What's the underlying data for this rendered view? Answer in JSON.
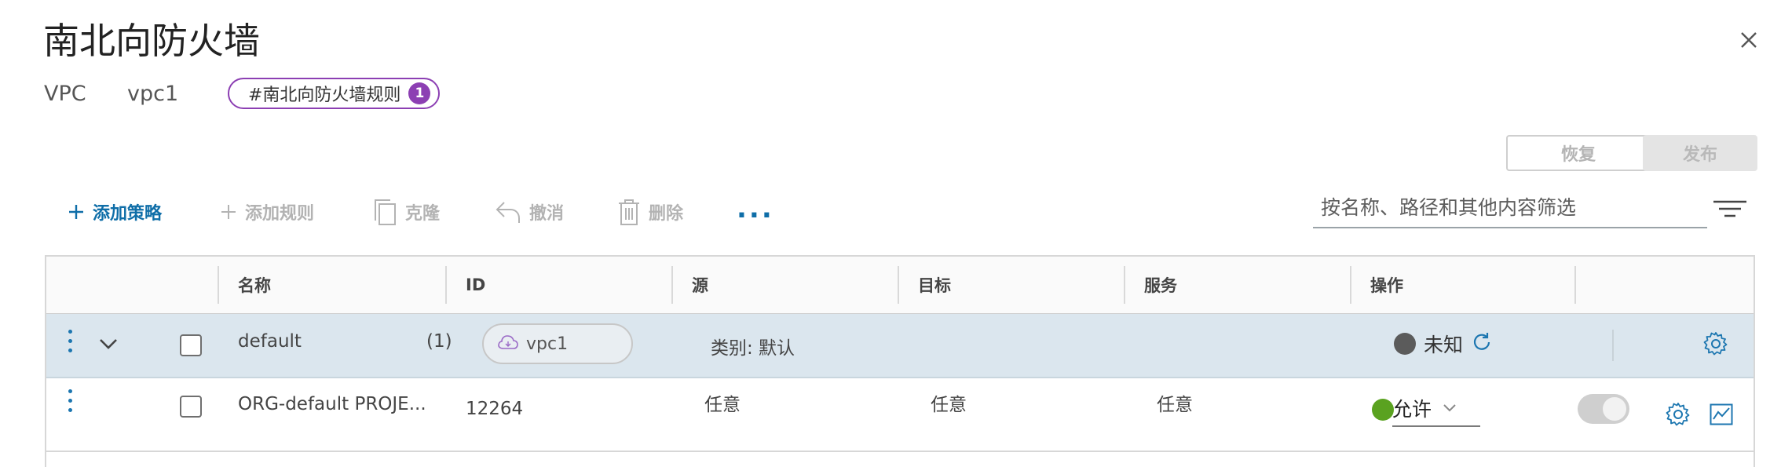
{
  "header": {
    "title": "南北向防火墙",
    "vpc_label": "VPC",
    "vpc_value": "vpc1",
    "rule_tag_label": "#南北向防火墙规则",
    "rule_tag_count": "1"
  },
  "buttons": {
    "revert": "恢复",
    "publish": "发布"
  },
  "toolbar": {
    "add_policy": "添加策略",
    "add_rule": "添加规则",
    "clone": "克隆",
    "undo": "撤消",
    "delete": "删除",
    "more": "..."
  },
  "filter": {
    "placeholder": "按名称、路径和其他内容筛选"
  },
  "table": {
    "columns": [
      "名称",
      "ID",
      "源",
      "目标",
      "服务",
      "操作"
    ],
    "group_row": {
      "name": "default",
      "count": "(1)",
      "applied_to": "vpc1",
      "category": "类别: 默认",
      "status": "未知"
    },
    "rule_row": {
      "name": "ORG-default PROJE...",
      "id": "12264",
      "source": "任意",
      "destination": "任意",
      "service": "任意",
      "action": "允许"
    }
  },
  "colors": {
    "accent": "#0f6ea8",
    "tag_purple": "#8c3fb3",
    "status_unknown": "#5b5b5b",
    "status_allow": "#5aa220",
    "group_row_bg": "#dbe6ee"
  }
}
